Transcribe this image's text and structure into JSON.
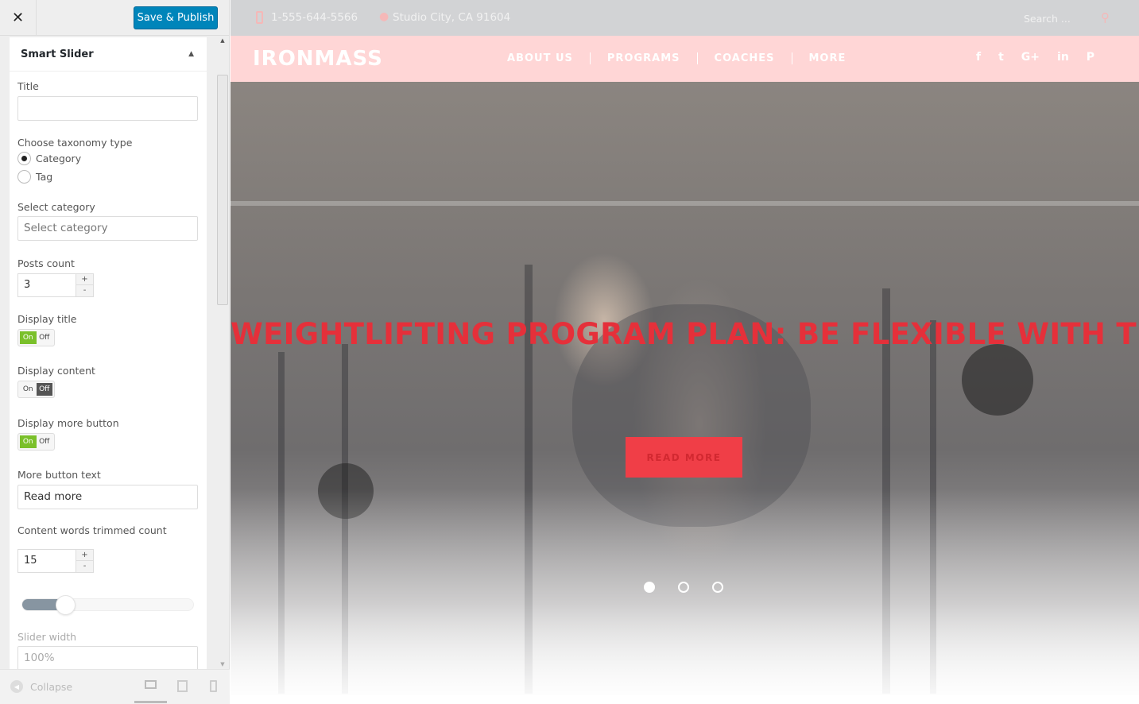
{
  "sidebar": {
    "close_icon": "close-icon",
    "save_label": "Save & Publish",
    "section_title": "Smart Slider",
    "fields": {
      "title_label": "Title",
      "title_value": "",
      "taxonomy_label": "Choose taxonomy type",
      "taxonomy_options": [
        "Category",
        "Tag"
      ],
      "taxonomy_selected": "Category",
      "category_label": "Select category",
      "category_placeholder": "Select category",
      "posts_count_label": "Posts count",
      "posts_count": "3",
      "display_title_label": "Display title",
      "display_title": "On",
      "display_content_label": "Display content",
      "display_content": "Off",
      "display_more_label": "Display more button",
      "display_more": "On",
      "toggle_on": "On",
      "toggle_off": "Off",
      "more_text_label": "More button text",
      "more_text": "Read more",
      "trim_label": "Content words trimmed count",
      "trim_count": "15",
      "stepper_plus": "+",
      "stepper_minus": "-",
      "slider_fraction": 0.25,
      "width_label": "Slider width",
      "width_placeholder": "100%"
    },
    "collapse_label": "Collapse"
  },
  "preview": {
    "phone": "1-555-644-5566",
    "address": "Studio City, CA 91604",
    "search_placeholder": "Search ...",
    "logo": "IRONMASS",
    "nav": [
      "ABOUT US",
      "PROGRAMS",
      "COACHES",
      "MORE"
    ],
    "social_icons": [
      "facebook-icon",
      "twitter-icon",
      "google-plus-icon",
      "linkedin-icon",
      "pinterest-icon"
    ],
    "social_glyphs": [
      "f",
      "t",
      "G+",
      "in",
      "P"
    ],
    "headline": "WEIGHTLIFTING PROGRAM PLAN: BE FLEXIBLE WITH THE P",
    "read_more": "READ MORE",
    "slides": 3,
    "active_slide": 1,
    "colors": {
      "accent": "#e5303a",
      "nav_bg": "#ffd6d6",
      "publish": "#0085ba",
      "toggle_on": "#7ac02a"
    }
  }
}
